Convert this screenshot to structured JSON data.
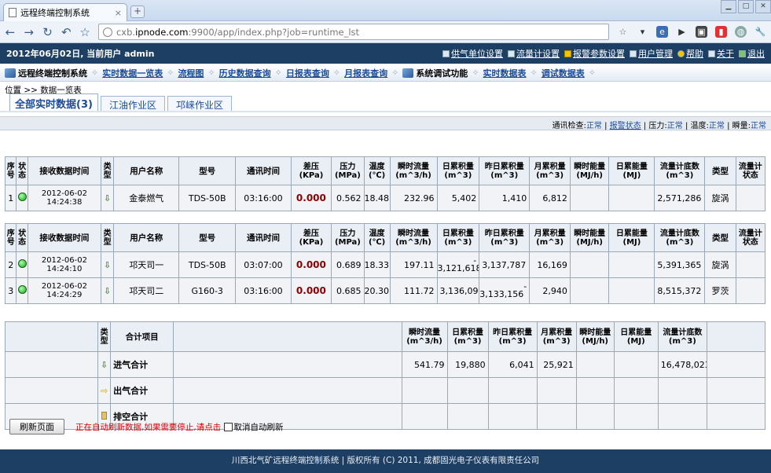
{
  "browser": {
    "tab_title": "远程终端控制系统",
    "tab_close": "×",
    "new_tab": "+",
    "url_host_prefix": "cxb.",
    "url_host_domain": "ipnode.com",
    "url_rest": ":9900/app/index.php?job=runtime_lst"
  },
  "topbar": {
    "date_user": "2012年06月02日, 当前用户",
    "user": "admin",
    "links": [
      "供气单位设置",
      "流量计设置",
      "报警参数设置",
      "用户管理",
      "帮助",
      "关于",
      "退出"
    ]
  },
  "menu": {
    "section1": "远程终端控制系统",
    "items1": [
      "实时数据一览表",
      "流程图",
      "历史数据查询",
      "日报表查询",
      "月报表查询"
    ],
    "section2": "系统调试功能",
    "items2": [
      "实时数据表",
      "调试数据表"
    ]
  },
  "breadcrumb": "位置 >> 数据一览表",
  "area_tabs": [
    "全部实时数据(3)",
    "江油作业区",
    "邛崃作业区"
  ],
  "status": {
    "comm_label": "通讯检查:",
    "comm_value": "正常",
    "alarm_link": "报警状态",
    "pressure_label": "压力:",
    "pressure_value": "正常",
    "temp_label": "温度:",
    "temp_value": "正常",
    "inst_label": "瞬量:",
    "inst_value": "正常"
  },
  "headers": {
    "seq": [
      "序",
      "号"
    ],
    "state": [
      "状",
      "态"
    ],
    "recv_time": "接收数据时间",
    "type": [
      "类",
      "型"
    ],
    "user_name": "用户名称",
    "model": "型号",
    "comm_time": "通讯时间",
    "diff_press": [
      "差压",
      "(KPa)"
    ],
    "pressure": [
      "压力",
      "(MPa)"
    ],
    "temp": [
      "温度",
      "(℃)"
    ],
    "inst_flow": [
      "瞬时流量",
      "(m^3/h)"
    ],
    "day_total": [
      "日累积量",
      "(m^3)"
    ],
    "yday_total": [
      "昨日累积量",
      "(m^3)"
    ],
    "month_total": [
      "月累积量",
      "(m^3)"
    ],
    "inst_energy": [
      "瞬时能量",
      "(MJ/h)"
    ],
    "day_energy": [
      "日累能量",
      "(MJ)"
    ],
    "meter_reading": [
      "流量计底数",
      "(m^3)"
    ],
    "meter_type": "类型",
    "meter_state": [
      "流量计",
      "状态"
    ]
  },
  "group1": [
    {
      "seq": "1",
      "date": "2012-06-02",
      "time": "14:24:38",
      "user": "金泰燃气",
      "model": "TDS-50B",
      "comm": "03:16:00",
      "dp": "0.000",
      "press": "0.562",
      "temp": "18.48",
      "inst": "232.96",
      "day": "5,402",
      "yday": "1,410",
      "month": "6,812",
      "ienergy": "",
      "denergy": "",
      "reading": "2,571,286",
      "mtype": "旋涡",
      "mstate": ""
    }
  ],
  "group2": [
    {
      "seq": "2",
      "date": "2012-06-02",
      "time": "14:24:10",
      "user": "邛天司一",
      "model": "TDS-50B",
      "comm": "03:07:00",
      "dp": "0.000",
      "press": "0.689",
      "temp": "18.33",
      "inst": "197.11",
      "day": "3,121,618",
      "day_neg": "-",
      "yday": "3,137,787",
      "month": "16,169",
      "ienergy": "",
      "denergy": "",
      "reading": "5,391,365",
      "mtype": "旋涡",
      "mstate": ""
    },
    {
      "seq": "3",
      "date": "2012-06-02",
      "time": "14:24:29",
      "user": "邛天司二",
      "model": "G160-3",
      "comm": "03:16:00",
      "dp": "0.000",
      "press": "0.685",
      "temp": "20.30",
      "inst": "111.72",
      "day": "3,136,096",
      "yday": "3,133,156",
      "yday_neg": "-",
      "month": "2,940",
      "ienergy": "",
      "denergy": "",
      "reading": "8,515,372",
      "mtype": "罗茨",
      "mstate": ""
    }
  ],
  "totals": {
    "item_header": "合计项目",
    "rows": [
      {
        "name": "进气合计",
        "inst": "541.79",
        "day": "19,880",
        "yday": "6,041",
        "month": "25,921",
        "ienergy": "",
        "denergy": "",
        "reading": "16,478,023"
      },
      {
        "name": "出气合计",
        "inst": "",
        "day": "",
        "yday": "",
        "month": "",
        "ienergy": "",
        "denergy": "",
        "reading": ""
      },
      {
        "name": "排空合计",
        "inst": "",
        "day": "",
        "yday": "",
        "month": "",
        "ienergy": "",
        "denergy": "",
        "reading": ""
      }
    ]
  },
  "bottom": {
    "refresh": "刷新页面",
    "message": "正在自动刷新数据,如果需要停止,请点击",
    "cancel_auto": "取消自动刷新"
  },
  "footer": "川西北气矿远程终端控制系统 | 版权所有 (C) 2011, 成都固光电子仪表有限责任公司",
  "colors": {
    "accent": "#1d3f64",
    "link": "#1a4b9b",
    "dp": "#8b0000",
    "alert": "#dd0000"
  }
}
